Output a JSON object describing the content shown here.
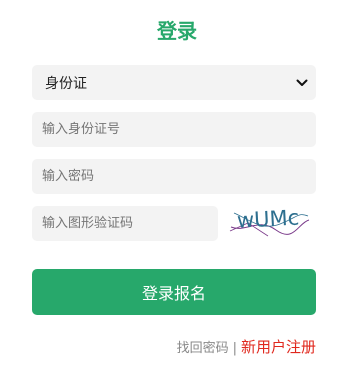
{
  "title": "登录",
  "id_type": {
    "selected": "身份证"
  },
  "fields": {
    "id_placeholder": "输入身份证号",
    "password_placeholder": "输入密码",
    "captcha_placeholder": "输入图形验证码"
  },
  "captcha": {
    "text": "wUMc",
    "text_color": "#2d6f8f",
    "noise_color": "#7a3a8a"
  },
  "login_button": "登录报名",
  "links": {
    "find_password": "找回密码",
    "separator": "|",
    "register": "新用户注册"
  },
  "colors": {
    "accent": "#27a86b",
    "register": "#e0281e",
    "field_bg": "#f3f3f3"
  },
  "icons": {
    "select_arrow": "chevron-down-icon"
  }
}
